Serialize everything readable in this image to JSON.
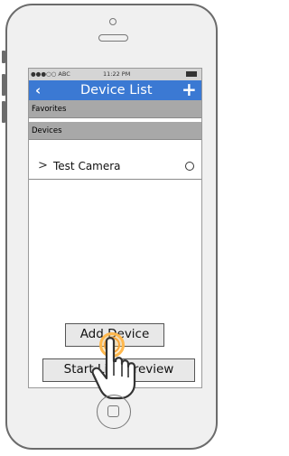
{
  "status_bar": {
    "carrier": "●●●○○ ABC",
    "time": "11:22 PM"
  },
  "nav": {
    "back_icon": "‹",
    "title": "Device List",
    "add_icon": "+"
  },
  "sections": {
    "favorites": "Favorites",
    "devices": "Devices"
  },
  "devices": [
    {
      "chevron": ">",
      "label": "Test Camera"
    }
  ],
  "buttons": {
    "add_device": "Add Device",
    "start_live_preview": "Start Live Preview"
  },
  "colors": {
    "nav_bar": "#3b79d3",
    "section_header": "#a8a8a8",
    "touch_highlight": "#ffb84d"
  },
  "icons": {
    "touch_indicator": "hand-pointer-icon",
    "home": "home-button-icon"
  }
}
